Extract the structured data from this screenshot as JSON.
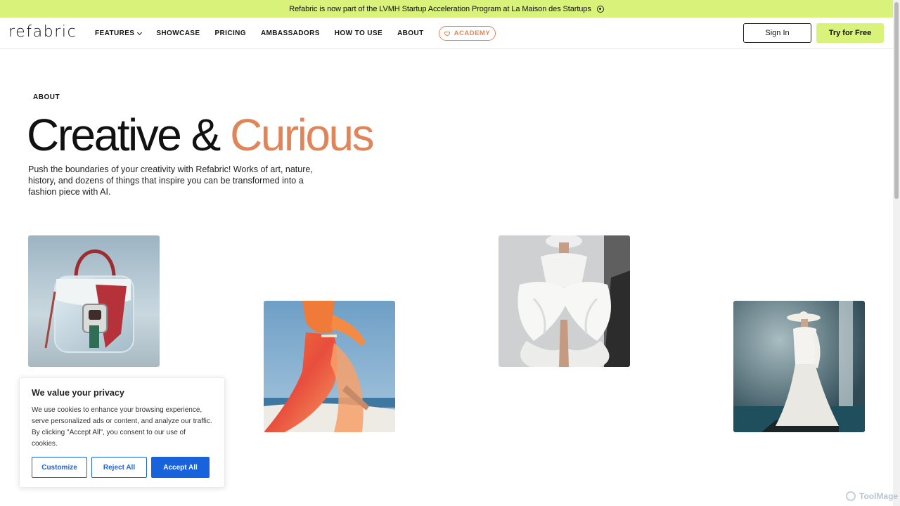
{
  "announcement": {
    "text": "Refabric is now part of the LVMH Startup Acceleration Program at La Maison des Startups",
    "icon": "close-circle-icon"
  },
  "header": {
    "logo": "refabric",
    "nav": [
      {
        "label": "FEATURES",
        "has_dropdown": true
      },
      {
        "label": "SHOWCASE"
      },
      {
        "label": "PRICING"
      },
      {
        "label": "AMBASSADORS"
      },
      {
        "label": "HOW TO USE"
      },
      {
        "label": "ABOUT"
      }
    ],
    "academy_label": "ACADEMY",
    "sign_in": "Sign In",
    "try_free": "Try for Free"
  },
  "hero": {
    "eyebrow": "ABOUT",
    "headline_main": "Creative & ",
    "headline_accent": "Curious",
    "intro": "Push the boundaries of your creativity with Refabric! Works of art, nature, history, and dozens of things that inspire you can be transformed into a fashion piece with AI."
  },
  "gallery": [
    {
      "subject": "transparent handbag"
    },
    {
      "subject": "orange flowing dress"
    },
    {
      "subject": "white sculptural gown"
    },
    {
      "subject": "white hat and gown by waterfall"
    }
  ],
  "cookie": {
    "title": "We value your privacy",
    "text": "We use cookies to enhance your browsing experience, serve personalized ads or content, and analyze our traffic. By clicking \"Accept All\", you consent to our use of cookies.",
    "customize": "Customize",
    "reject": "Reject All",
    "accept": "Accept All"
  },
  "watermark": "ToolMage",
  "colors": {
    "lime": "#d8f27a",
    "accent": "#e0855a",
    "blue": "#1863dc"
  }
}
